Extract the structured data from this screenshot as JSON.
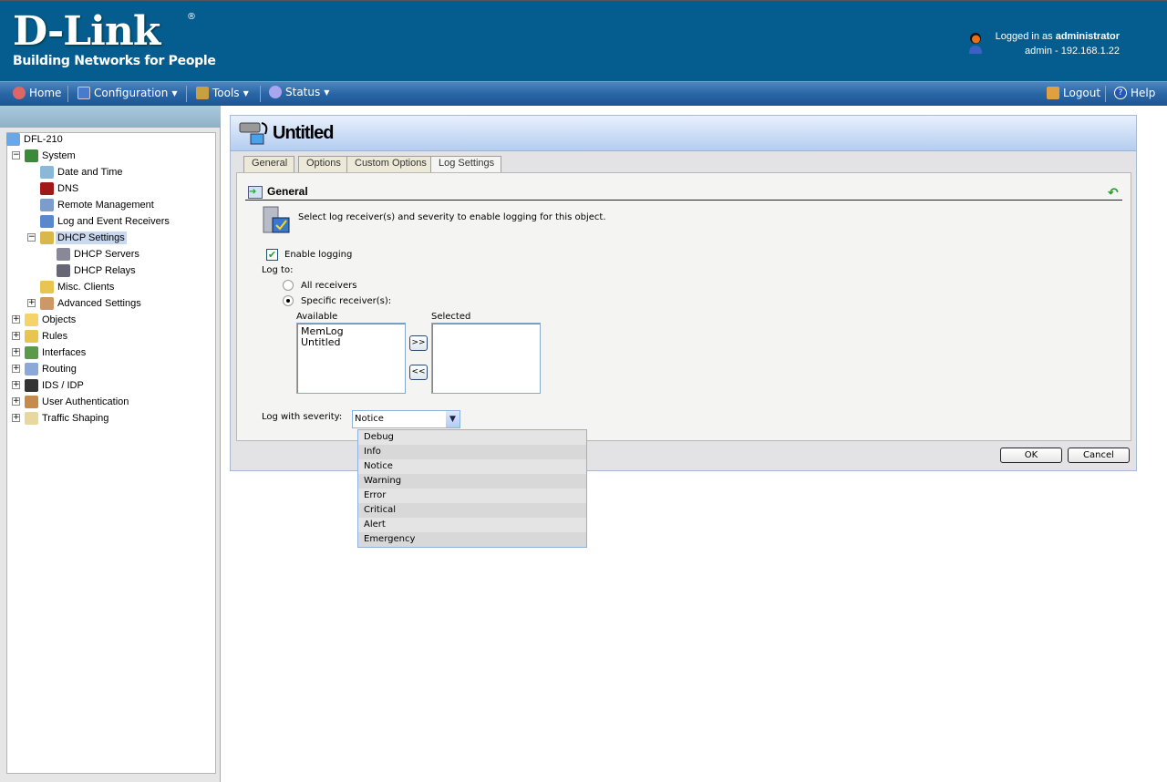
{
  "header": {
    "logo": "D-Link",
    "logo_reg": "®",
    "tagline": "Building Networks for People",
    "logged_in_prefix": "Logged in as ",
    "user": "administrator",
    "session": "admin - 192.168.1.22"
  },
  "nav": {
    "home": "Home",
    "configuration": "Configuration",
    "tools": "Tools",
    "status": "Status",
    "logout": "Logout",
    "help": "Help"
  },
  "tree": {
    "root": "DFL-210",
    "items": [
      "System",
      "Date and Time",
      "DNS",
      "Remote Management",
      "Log and Event Receivers",
      "DHCP Settings",
      "DHCP Servers",
      "DHCP Relays",
      "Misc. Clients",
      "Advanced Settings",
      "Objects",
      "Rules",
      "Interfaces",
      "Routing",
      "IDS / IDP",
      "User Authentication",
      "Traffic Shaping"
    ],
    "selected": "DHCP Servers"
  },
  "dialog": {
    "title": "Untitled",
    "tabs": [
      "General",
      "Options",
      "Custom Options",
      "Log Settings"
    ],
    "active_tab": "Log Settings",
    "section_title": "General",
    "description": "Select log receiver(s) and severity to enable logging for this object.",
    "enable_logging_label": "Enable logging",
    "enable_logging": true,
    "log_to_label": "Log to:",
    "radio_all": "All receivers",
    "radio_specific": "Specific receiver(s):",
    "log_to_selected": "Specific receiver(s):",
    "available_label": "Available",
    "available": [
      "MemLog",
      "Untitled"
    ],
    "selected_label": "Selected",
    "selected": [],
    "add_btn": ">>",
    "remove_btn": "<<",
    "severity_label": "Log with severity:",
    "severity_value": "Notice",
    "severity_options": [
      "Debug",
      "Info",
      "Notice",
      "Warning",
      "Error",
      "Critical",
      "Alert",
      "Emergency"
    ],
    "ok": "OK",
    "cancel": "Cancel"
  },
  "colors": {
    "header": "#055d8f",
    "navbar": "#2a66a6",
    "title_bar": "#b4cdf0"
  }
}
